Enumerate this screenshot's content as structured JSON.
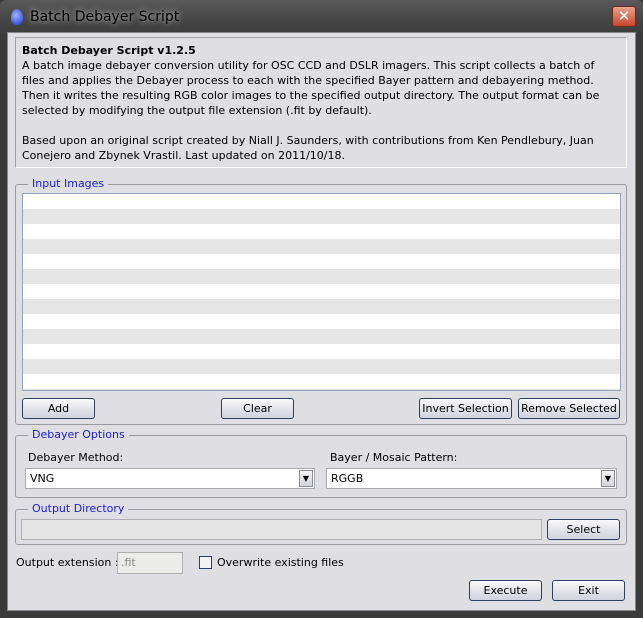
{
  "window": {
    "title": "Batch Debayer Script",
    "close_label": "✕"
  },
  "description": {
    "heading": "Batch Debayer Script v1.2.5",
    "body": "A batch image debayer conversion utility for OSC CCD and DSLR imagers. This script collects a batch of files and applies the Debayer process to each with the specified Bayer pattern and debayering method. Then it writes the resulting RGB color images to the specified output directory. The output format can be selected by modifying the output file extension (.fit by default).",
    "credits": "Based upon an original script created by Niall J. Saunders, with contributions from Ken Pendlebury, Juan Conejero and Zbynek Vrastil. Last updated on 2011/10/18."
  },
  "input_images": {
    "title": "Input Images",
    "add": "Add",
    "clear": "Clear",
    "invert": "Invert Selection",
    "remove": "Remove Selected"
  },
  "debayer_options": {
    "title": "Debayer Options",
    "method_label": "Debayer Method:",
    "method_value": "VNG",
    "pattern_label": "Bayer / Mosaic Pattern:",
    "pattern_value": "RGGB"
  },
  "output_directory": {
    "title": "Output Directory",
    "value": "",
    "select": "Select"
  },
  "output_extension": {
    "label": "Output extension :",
    "value": ".fit"
  },
  "overwrite": {
    "label": "Overwrite existing files",
    "checked": false
  },
  "actions": {
    "execute": "Execute",
    "exit": "Exit"
  },
  "colors": {
    "accent_legend": "#1a1ae0",
    "background": "#dfdfe3"
  }
}
